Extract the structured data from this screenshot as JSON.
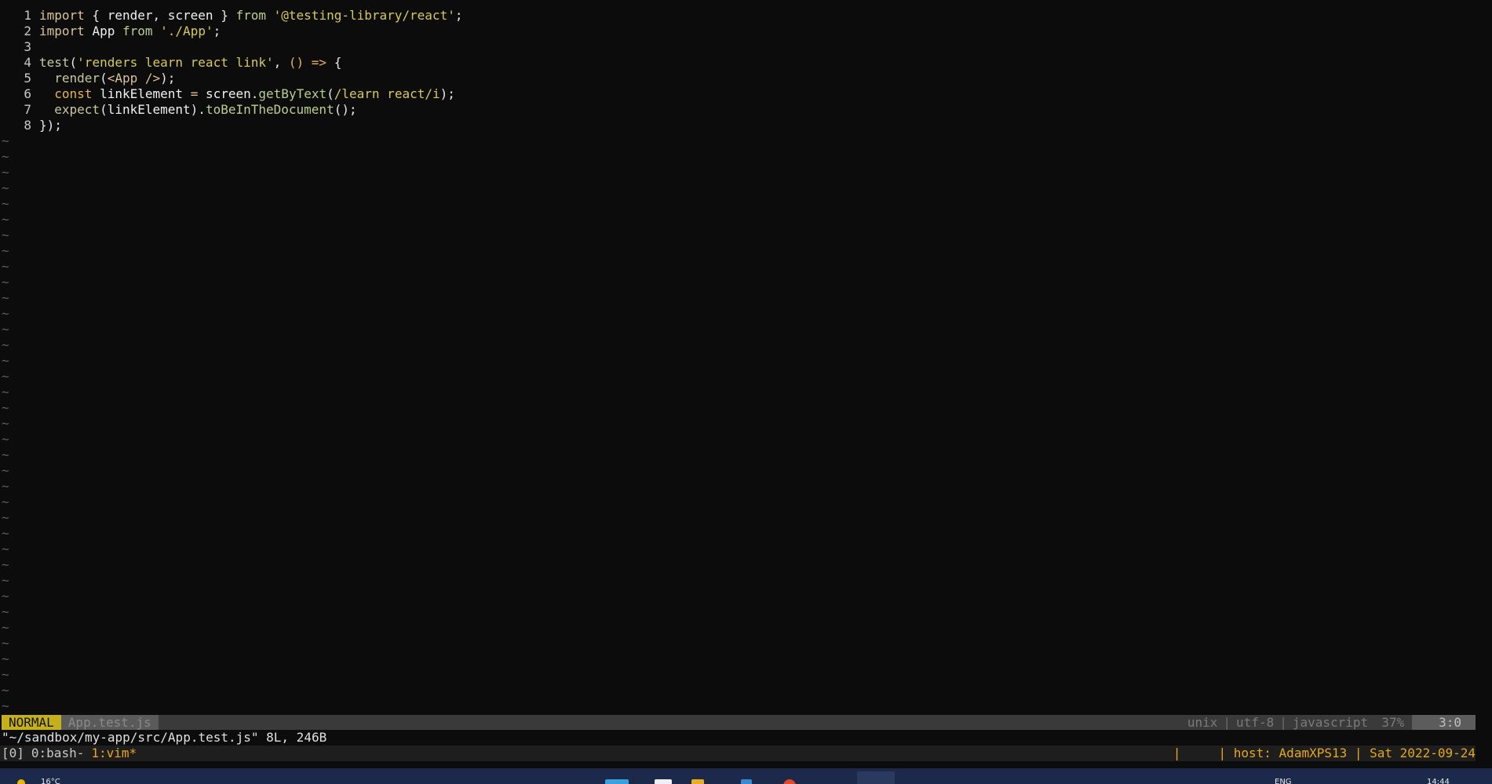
{
  "editor": {
    "lines": [
      {
        "n": "1",
        "tokens": [
          [
            "kw",
            "import"
          ],
          [
            "pu",
            " { "
          ],
          [
            "id",
            "render"
          ],
          [
            "pu",
            ", "
          ],
          [
            "id",
            "screen"
          ],
          [
            "pu",
            " } "
          ],
          [
            "mth",
            "from"
          ],
          [
            "pu",
            " "
          ],
          [
            "str",
            "'@testing-library/react'"
          ],
          [
            "pu",
            ";"
          ]
        ]
      },
      {
        "n": "2",
        "tokens": [
          [
            "kw",
            "import"
          ],
          [
            "pu",
            " "
          ],
          [
            "id",
            "App"
          ],
          [
            "pu",
            " "
          ],
          [
            "mth",
            "from"
          ],
          [
            "pu",
            " "
          ],
          [
            "str",
            "'./App'"
          ],
          [
            "pu",
            ";"
          ]
        ]
      },
      {
        "n": "3",
        "tokens": []
      },
      {
        "n": "4",
        "tokens": [
          [
            "fn",
            "test"
          ],
          [
            "pu",
            "("
          ],
          [
            "str",
            "'renders learn react link'"
          ],
          [
            "pu",
            ", "
          ],
          [
            "kw2",
            "() => "
          ],
          [
            "pu",
            "{"
          ]
        ]
      },
      {
        "n": "5",
        "tokens": [
          [
            "pu",
            "  "
          ],
          [
            "fn",
            "render"
          ],
          [
            "pu",
            "("
          ],
          [
            "op",
            "<"
          ],
          [
            "kw",
            "App"
          ],
          [
            "op",
            " />"
          ],
          [
            "pu",
            ");"
          ]
        ]
      },
      {
        "n": "6",
        "tokens": [
          [
            "pu",
            "  "
          ],
          [
            "kw2",
            "const"
          ],
          [
            "pu",
            " "
          ],
          [
            "id",
            "linkElement"
          ],
          [
            "pu",
            " "
          ],
          [
            "op",
            "="
          ],
          [
            "pu",
            " "
          ],
          [
            "id",
            "screen"
          ],
          [
            "pu",
            "."
          ],
          [
            "mth",
            "getByText"
          ],
          [
            "pu",
            "("
          ],
          [
            "str",
            "/learn react/i"
          ],
          [
            "pu",
            ");"
          ]
        ]
      },
      {
        "n": "7",
        "tokens": [
          [
            "pu",
            "  "
          ],
          [
            "fn",
            "expect"
          ],
          [
            "pu",
            "("
          ],
          [
            "id",
            "linkElement"
          ],
          [
            "pu",
            ")."
          ],
          [
            "mth",
            "toBeInTheDocument"
          ],
          [
            "pu",
            "();"
          ]
        ]
      },
      {
        "n": "8",
        "tokens": [
          [
            "pu",
            "});"
          ]
        ]
      }
    ],
    "tilde": "~",
    "tilde_count": 37
  },
  "statusline": {
    "mode": "NORMAL",
    "filename": "App.test.js",
    "fileformat": "unix",
    "encoding": "utf-8",
    "filetype": "javascript",
    "percent": "37%",
    "position": "3:0",
    "separator": "|"
  },
  "message": "\"~/sandbox/my-app/src/App.test.js\" 8L, 246B",
  "tmux": {
    "session": "[0]",
    "window0": "0:bash-",
    "window1": "1:vim*",
    "right": "|     | host: AdamXPS13 | Sat 2022-09-24"
  },
  "taskbar": {
    "weather": "16°C",
    "language": "ENG",
    "time": "14:44"
  },
  "colors": {
    "terminal_bg": "#0c0c0c",
    "mode_bg": "#c5b01b",
    "tmux_accent": "#e6a817",
    "taskbar_bg": "#1b2a4a"
  }
}
